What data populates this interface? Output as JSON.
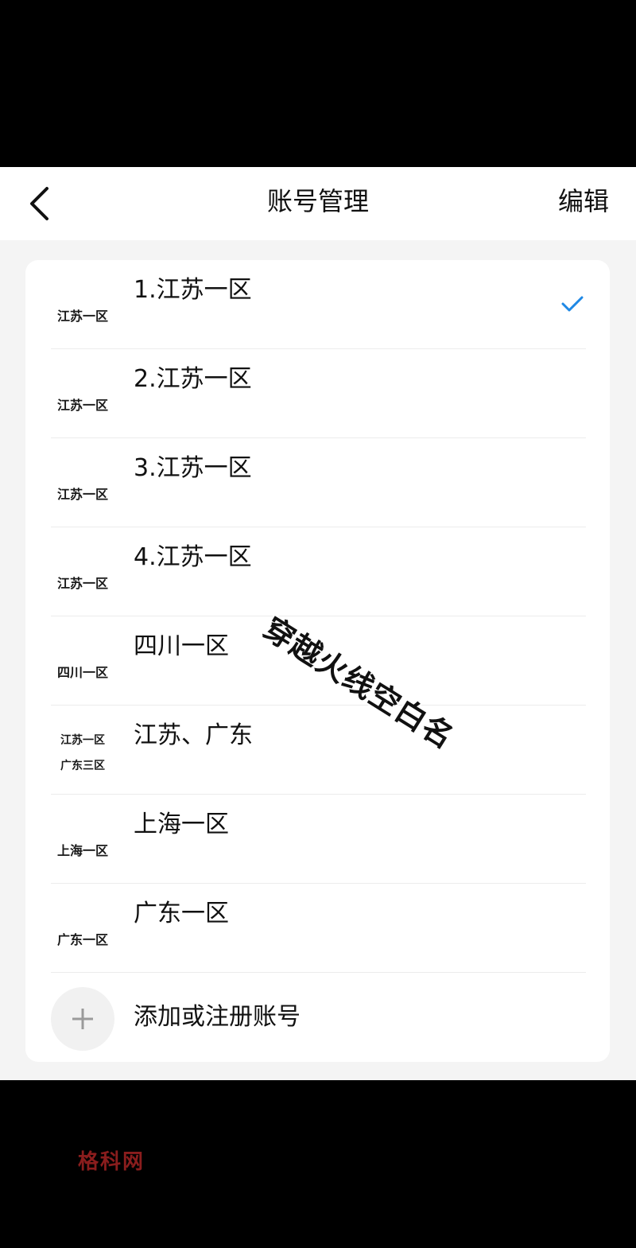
{
  "header": {
    "title": "账号管理",
    "edit_label": "编辑"
  },
  "accounts": [
    {
      "avatar_lines": [
        "江苏一区"
      ],
      "name": "1.江苏一区",
      "selected": true
    },
    {
      "avatar_lines": [
        "江苏一区"
      ],
      "name": "2.江苏一区",
      "selected": false
    },
    {
      "avatar_lines": [
        "江苏一区"
      ],
      "name": "3.江苏一区",
      "selected": false
    },
    {
      "avatar_lines": [
        "江苏一区"
      ],
      "name": "4.江苏一区",
      "selected": false
    },
    {
      "avatar_lines": [
        "四川一区"
      ],
      "name": "四川一区",
      "selected": false
    },
    {
      "avatar_lines": [
        "江苏一区",
        "广东三区"
      ],
      "name": "江苏、广东",
      "selected": false
    },
    {
      "avatar_lines": [
        "上海一区"
      ],
      "name": "上海一区",
      "selected": false
    },
    {
      "avatar_lines": [
        "广东一区"
      ],
      "name": "广东一区",
      "selected": false
    }
  ],
  "add_account": {
    "label": "添加或注册账号",
    "icon": "plus-icon"
  },
  "overlay_text": "穿越火线空白名",
  "site_logo": "格科网",
  "colors": {
    "check": "#1e88e5",
    "background": "#f4f4f4",
    "card": "#ffffff"
  }
}
